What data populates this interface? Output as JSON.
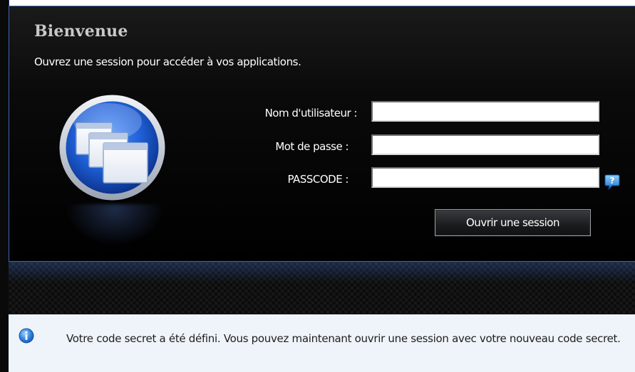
{
  "login": {
    "title": "Bienvenue",
    "subtitle": "Ouvrez une session pour accéder à vos applications.",
    "fields": {
      "username": {
        "label": "Nom d'utilisateur :",
        "value": ""
      },
      "password": {
        "label": "Mot de passe :",
        "value": ""
      },
      "passcode": {
        "label": "PASSCODE :",
        "value": ""
      }
    },
    "submit_label": "Ouvrir une session"
  },
  "message": {
    "text": "Votre code secret a été défini. Vous pouvez maintenant ouvrir une session avec votre nouveau code secret."
  },
  "icons": {
    "app": "applications-windows-icon",
    "help": "help-question-icon",
    "info": "info-icon"
  },
  "colors": {
    "panel_background": "#000000",
    "panel_border": "#3b66b0",
    "title_text": "#c8c8c8",
    "label_text": "#ffffff",
    "icon_blue": "#1f5fd6",
    "info_background": "#eff4fa",
    "info_icon": "#2f7fe0"
  }
}
